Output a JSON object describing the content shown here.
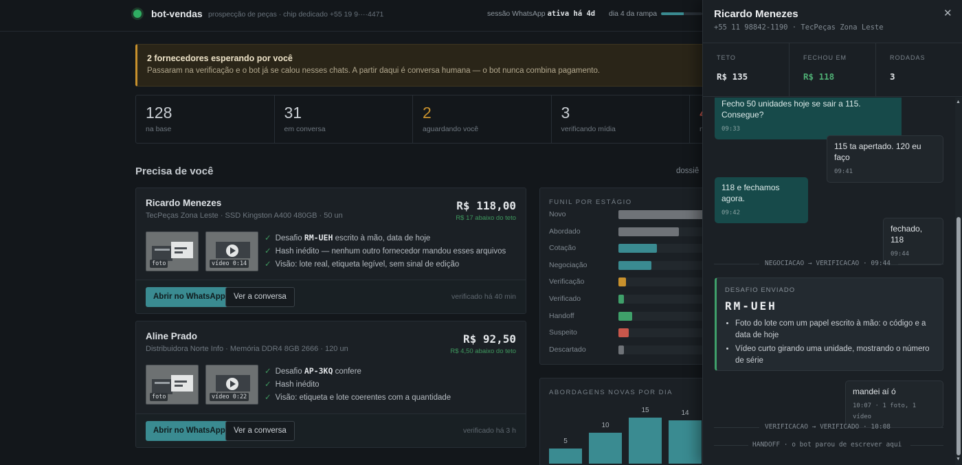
{
  "topbar": {
    "app_name": "bot-vendas",
    "subtitle": "prospecção de peças · chip dedicado +55 19 9····4471",
    "session_label": "sessão WhatsApp",
    "session_state": "ativa há 4d",
    "ramp_label": "dia 4 da rampa",
    "ramp_progress": 0.55
  },
  "alert": {
    "title": "2 fornecedores esperando por você",
    "body": "Passaram na verificação e o bot já se calou nesses chats. A partir daqui é conversa humana — o bot nunca combina pagamento."
  },
  "stats": [
    {
      "value": "128",
      "label": "na base"
    },
    {
      "value": "31",
      "label": "em conversa"
    },
    {
      "value": "2",
      "label": "aguardando você"
    },
    {
      "value": "3",
      "label": "verificando mídia"
    },
    {
      "value": "4",
      "label": "n"
    }
  ],
  "section": {
    "title": "Precisa de você",
    "link": "dossiê"
  },
  "cards": [
    {
      "name": "Ricardo Menezes",
      "sub": "TecPeças Zona Leste · SSD Kingston A400 480GB · 50 un",
      "price": "R$ 118,00",
      "delta": "R$ 17 abaixo do teto",
      "thumb_photo": "foto",
      "thumb_video": "vídeo 0:14",
      "checks": [
        {
          "pre": "Desafio ",
          "code": "RM-UEH",
          "post": " escrito à mão, data de hoje"
        },
        {
          "pre": "Hash inédito — nenhum outro fornecedor mandou esses arquivos",
          "code": "",
          "post": ""
        },
        {
          "pre": "Visão: lote real, etiqueta legível, sem sinal de edição",
          "code": "",
          "post": ""
        }
      ],
      "primary": "Abrir no WhatsApp",
      "secondary": "Ver a conversa",
      "verified": "verificado há 40 min"
    },
    {
      "name": "Aline Prado",
      "sub": "Distribuidora Norte Info · Memória DDR4 8GB 2666 · 120 un",
      "price": "R$ 92,50",
      "delta": "R$ 4,50 abaixo do teto",
      "thumb_photo": "foto",
      "thumb_video": "vídeo 0:22",
      "checks": [
        {
          "pre": "Desafio ",
          "code": "AP-3KQ",
          "post": " confere"
        },
        {
          "pre": "Hash inédito",
          "code": "",
          "post": ""
        },
        {
          "pre": "Visão: etiqueta e lote coerentes com a quantidade",
          "code": "",
          "post": ""
        }
      ],
      "primary": "Abrir no WhatsApp",
      "secondary": "Ver a conversa",
      "verified": "verificado há 3 h"
    }
  ],
  "funnel": {
    "title": "FUNIL POR ESTÁGIO",
    "stages": [
      {
        "label": "Novo",
        "share": 0.9,
        "color": "#6f7378"
      },
      {
        "label": "Abordado",
        "share": 0.63,
        "color": "#6f7378"
      },
      {
        "label": "Cotação",
        "share": 0.4,
        "color": "#3a8b91"
      },
      {
        "label": "Negociação",
        "share": 0.34,
        "color": "#3a8b91"
      },
      {
        "label": "Verificação",
        "share": 0.08,
        "color": "#c8912d"
      },
      {
        "label": "Verificado",
        "share": 0.06,
        "color": "#3fa06a"
      },
      {
        "label": "Handoff",
        "share": 0.14,
        "color": "#3fa06a"
      },
      {
        "label": "Suspeito",
        "share": 0.11,
        "color": "#c9574b"
      },
      {
        "label": "Descartado",
        "share": 0.06,
        "color": "#6f7378"
      }
    ]
  },
  "chart_data": {
    "type": "bar",
    "title": "ABORDAGENS NOVAS POR DIA",
    "categories": [
      "",
      "",
      "",
      ""
    ],
    "values": [
      5,
      10,
      15,
      14
    ],
    "ylim": [
      0,
      18
    ]
  },
  "panel": {
    "name": "Ricardo Menezes",
    "sub": "+55 11 98842-1190 · TecPeças Zona Leste",
    "close": "✕",
    "stats": [
      {
        "k": "TETO",
        "v": "R$ 135"
      },
      {
        "k": "FECHOU EM",
        "v": "R$ 118"
      },
      {
        "k": "RODADAS",
        "v": "3"
      }
    ],
    "messages": [
      {
        "text": "Fecho 50 unidades hoje se sair a 115. Consegue?",
        "time": "09:33"
      },
      {
        "text": "115 ta apertado. 120 eu faço",
        "time": "09:41"
      },
      {
        "text": "118 e fechamos agora.",
        "time": "09:42"
      },
      {
        "text": "fechado, 118",
        "time": "09:44"
      },
      {
        "text": "mandei aí ó",
        "time": "10:07 · 1 foto, 1 vídeo"
      }
    ],
    "separators": [
      "NEGOCIACAO → VERIFICACAO · 09:44",
      "VERIFICACAO → VERIFICADO · 10:08",
      "HANDOFF · o bot parou de escrever aqui"
    ],
    "challenge": {
      "k": "DESAFIO ENVIADO",
      "code": "RM-UEH",
      "items": [
        "Foto do lote com um papel escrito à mão: o código e a data de hoje",
        "Vídeo curto girando uma unidade, mostrando o número de série"
      ]
    }
  }
}
